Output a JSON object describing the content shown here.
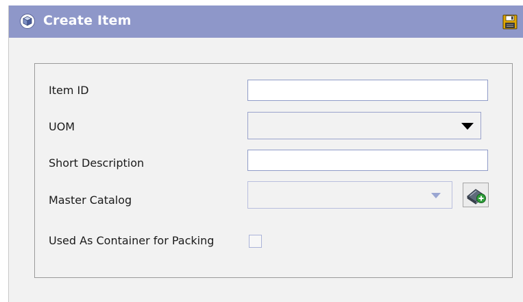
{
  "window": {
    "title": "Create Item",
    "title_icon": "cube-icon",
    "save_icon": "floppy-disk-icon"
  },
  "form": {
    "item_id": {
      "label": "Item ID",
      "value": ""
    },
    "uom": {
      "label": "UOM",
      "value": ""
    },
    "short_description": {
      "label": "Short Description",
      "value": ""
    },
    "master_catalog": {
      "label": "Master Catalog",
      "value": "",
      "lookup_icon": "book-add-icon"
    },
    "container_for_packing": {
      "label": "Used As Container for Packing",
      "checked": false
    }
  },
  "colors": {
    "titlebar": "#8e97c9",
    "background": "#f2f2f2",
    "field_border": "#8f9bc7"
  }
}
